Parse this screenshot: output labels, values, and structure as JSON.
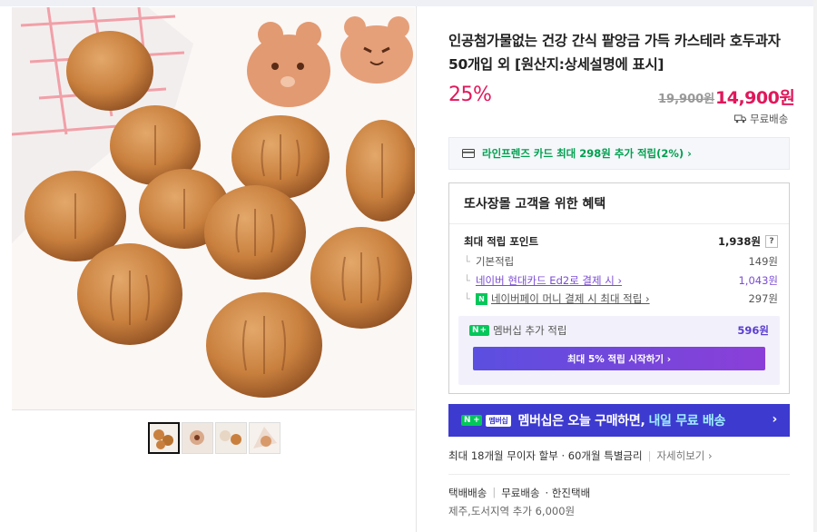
{
  "product": {
    "title": "인공첨가물없는 건강 간식 팥앙금 가득 카스테라 호두과자 50개입 외 [원산지:상세설명에 표시]",
    "discount_rate": "25%",
    "original_price": "19,900원",
    "sale_price": "14,900원",
    "shipping_label": "무료배송"
  },
  "card_banner": {
    "text": "라인프렌즈 카드 최대 298원 추가 적립(2%) ›"
  },
  "benefits": {
    "title": "또사장몰 고객을 위한 혜택",
    "max_points_label": "최대 적립 포인트",
    "max_points_value": "1,938원",
    "help": "?",
    "rows": [
      {
        "label": "기본적립",
        "value": "149원"
      },
      {
        "label": "네이버 현대카드 Ed2로 결제 시 ›",
        "value": "1,043원"
      },
      {
        "label": "네이버페이 머니 결제 시 최대 적립 ›",
        "value": "297원"
      }
    ],
    "membership_label": "멤버십 추가 적립",
    "membership_value": "596원",
    "start_button": "최대 5% 적립 시작하기 ›"
  },
  "promo": {
    "badge": "N +",
    "tag": "멤버십",
    "text": "멤버십은 오늘 구매하면,",
    "highlight": "내일 무료 배송",
    "arrow": "›"
  },
  "installment": {
    "text": "최대 18개월 무이자 할부 · 60개월 특별금리",
    "more": "자세히보기 ›"
  },
  "delivery": {
    "type": "택배배송",
    "fee": "무료배송",
    "carrier": "· 한진택배",
    "extra": "제주,도서지역 추가 6,000원"
  },
  "thumbnails": [
    "thumb-1",
    "thumb-2",
    "thumb-3",
    "thumb-4"
  ],
  "colors": {
    "accent": "#e0185b",
    "naver_green": "#03c75a",
    "membership_purple": "#5b3fd1",
    "promo_blue": "#3d3ad0"
  }
}
